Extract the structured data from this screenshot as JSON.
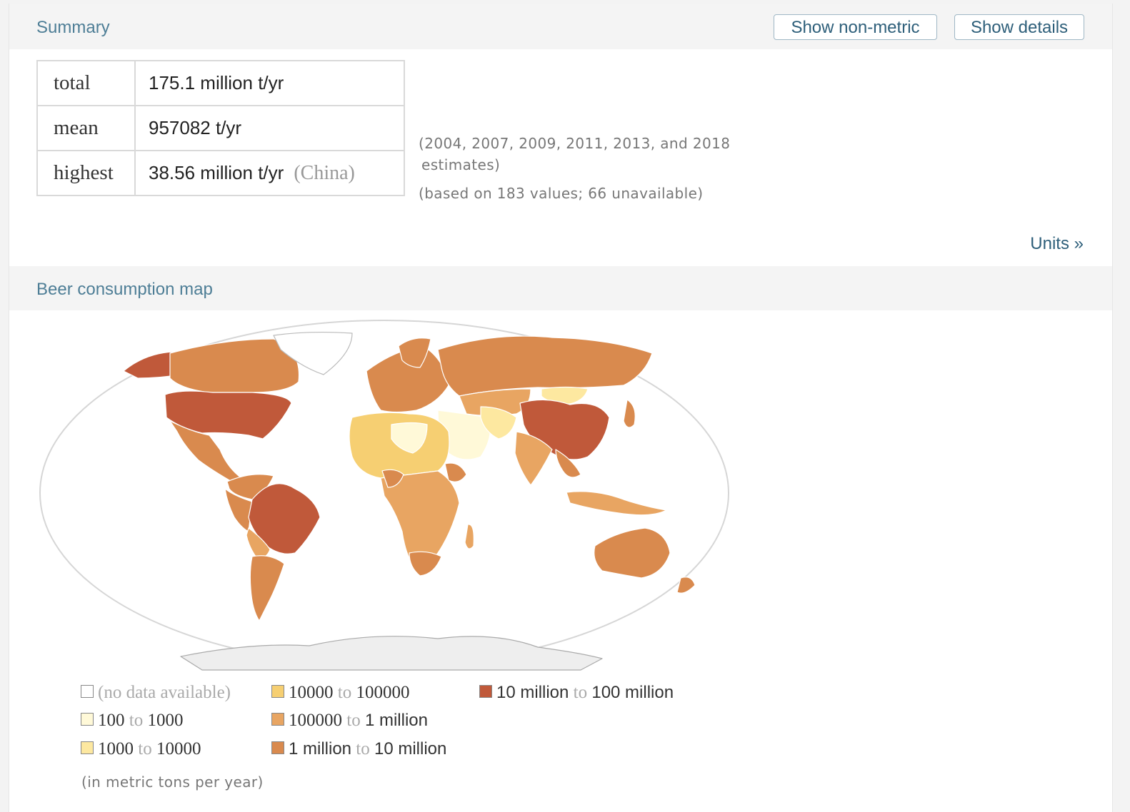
{
  "summary": {
    "title": "Summary",
    "buttons": {
      "non_metric": "Show non-metric",
      "details": "Show details"
    },
    "rows": [
      {
        "key": "total",
        "value": "175.1 million t/yr"
      },
      {
        "key": "mean",
        "value": "957082 t/yr"
      },
      {
        "key": "highest",
        "value": "38.56 million t/yr",
        "note": "(China)"
      }
    ],
    "note_years_line1": "(2004, 2007, 2009, 2011, 2013, and 2018",
    "note_years_line2": "estimates)",
    "note_values": "(based on 183 values; 66 unavailable)",
    "units_link": "Units »"
  },
  "map": {
    "title": "Beer consumption map",
    "legend": [
      {
        "label": "(no data available)",
        "color": "#ffffff"
      },
      {
        "from": "100",
        "to": "1000",
        "color": "#fff9d8"
      },
      {
        "from": "1000",
        "to": "10000",
        "color": "#fde8a0"
      },
      {
        "from": "10000",
        "to": "100000",
        "color": "#f6cf72"
      },
      {
        "from": "100000",
        "to": "1 million",
        "color": "#e8a562"
      },
      {
        "from": "1 million",
        "to": "10 million",
        "color": "#d98a4e"
      },
      {
        "from": "10 million",
        "to": "100 million",
        "color": "#c0593a"
      }
    ],
    "to_word": "to",
    "unit_note": "(in metric tons per year)"
  }
}
